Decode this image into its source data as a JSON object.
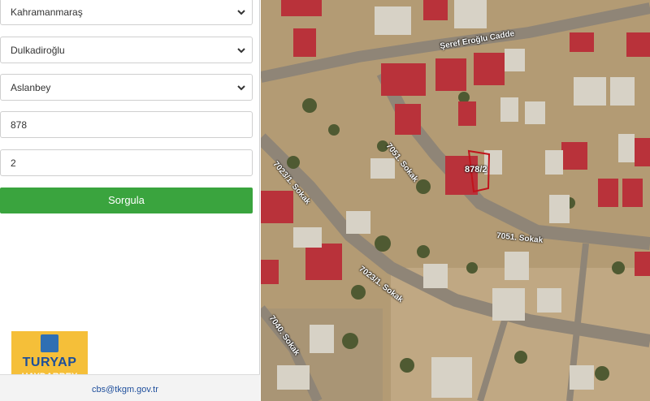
{
  "form": {
    "province_value": "Kahramanmaraş",
    "district_value": "Dulkadiroğlu",
    "neighborhood_value": "Aslanbey",
    "block_value": "878",
    "parcel_value": "2",
    "query_button_label": "Sorgula"
  },
  "footer": {
    "email": "cbs@tkgm.gov.tr"
  },
  "logo": {
    "line1": "TURYAP",
    "line2": "HAYDARBEY"
  },
  "map": {
    "parcel_label": "878/2",
    "streets": {
      "seref_eroglu": "Şeref Eroğlu Cadde",
      "s7051_vertical": "7051. Sokak",
      "s7051_horizontal": "7051. Sokak",
      "s7023_1_upper": "7023/1. Sokak",
      "s7023_1_lower": "7023/1. Sokak",
      "s7040": "7040. Sokak"
    }
  },
  "colors": {
    "query_button": "#3aa43e",
    "parcel_outline": "#c0141c",
    "logo_bg": "#f5bf39"
  }
}
